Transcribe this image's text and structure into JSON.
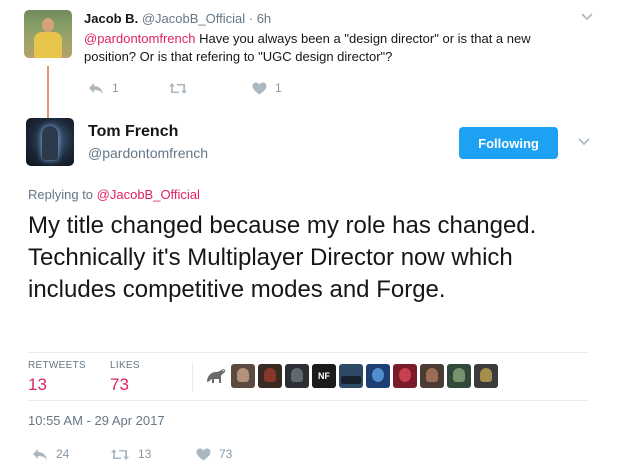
{
  "parent_tweet": {
    "name": "Jacob B.",
    "handle": "@JacobB_Official",
    "separator": "·",
    "time": "6h",
    "mention": "@pardontomfrench",
    "text": " Have you always been a \"design director\" or is that a new position? Or is that refering to \"UGC design director\"?",
    "actions": {
      "reply_count": "1",
      "retweet_count": "",
      "like_count": "1"
    }
  },
  "main_tweet": {
    "name": "Tom French",
    "handle": "@pardontomfrench",
    "follow_label": "Following",
    "replying_prefix": "Replying to ",
    "replying_to": "@JacobB_Official",
    "text": "My title changed because my role has changed. Technically it's Multiplayer Director now which includes competitive modes and Forge.",
    "stats": {
      "retweets_label": "RETWEETS",
      "retweets_value": "13",
      "likes_label": "LIKES",
      "likes_value": "73"
    },
    "likers": [
      {
        "icon": "dinosaur-avatar",
        "color": "#ffffff"
      },
      {
        "icon": "person-avatar",
        "color": "#5b4a3f"
      },
      {
        "icon": "character-avatar",
        "color": "#3a2a24"
      },
      {
        "icon": "soldier-avatar",
        "color": "#2c2f33"
      },
      {
        "icon": "nf-logo",
        "color": "#1b1b1b",
        "text": "NF"
      },
      {
        "icon": "landscape-avatar",
        "color": "#2f4a66"
      },
      {
        "icon": "blue-logo-avatar",
        "color": "#1d3f73"
      },
      {
        "icon": "red-logo-avatar",
        "color": "#7a1a2a"
      },
      {
        "icon": "fighter-avatar",
        "color": "#4a3b33"
      },
      {
        "icon": "spartan-avatar",
        "color": "#2f4a3a"
      },
      {
        "icon": "helmet-avatar",
        "color": "#3b3b3b"
      }
    ],
    "timestamp": "10:55 AM - 29 Apr 2017",
    "actions": {
      "reply_count": "24",
      "retweet_count": "13",
      "like_count": "73"
    }
  },
  "colors": {
    "accent_blue": "#1da1f2",
    "mention_red": "#e0245e",
    "muted_gray": "#657786",
    "action_gray": "#8899a6",
    "thread_line": "#f08f78"
  }
}
